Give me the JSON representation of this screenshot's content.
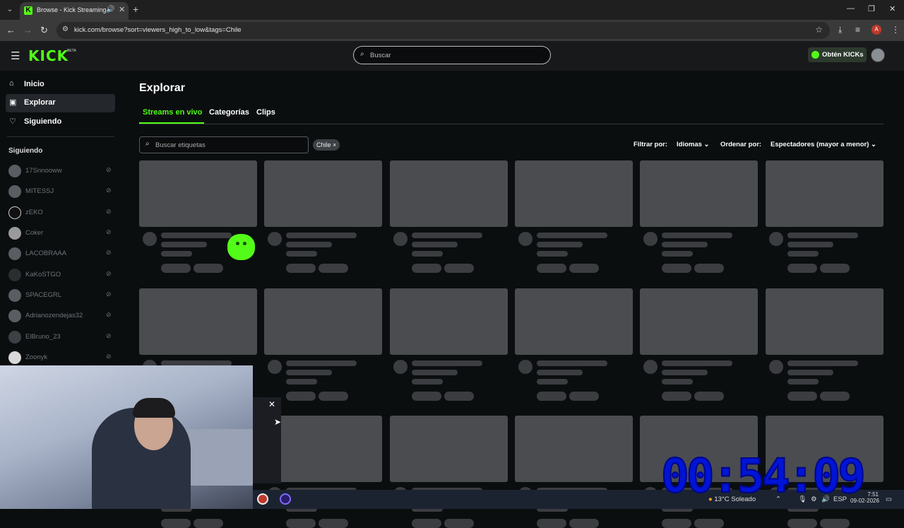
{
  "browser": {
    "tab_title": "Browse - Kick Streaming",
    "url": "kick.com/browse?sort=viewers_high_to_low&tags=Chile",
    "profile_initial": "A"
  },
  "header": {
    "logo": "KICK",
    "beta": "BETA",
    "search_placeholder": "Buscar",
    "get_kicks": "Obtén KICKs"
  },
  "sidebar": {
    "items": [
      {
        "label": "Inicio",
        "icon": "home-icon"
      },
      {
        "label": "Explorar",
        "icon": "browse-icon"
      },
      {
        "label": "Siguiendo",
        "icon": "heart-icon"
      }
    ],
    "following_heading": "Siguiendo",
    "following": [
      "17Snnooww",
      "MITESSJ",
      "zEKO",
      "Coker",
      "LACOBRAAA",
      "KaKoSTGO",
      "SPACEGRL",
      "Adrianozendejas32",
      "ElBruno_23",
      "Zoonyk"
    ]
  },
  "main": {
    "title": "Explorar",
    "tabs": [
      "Streams en vivo",
      "Categorías",
      "Clips"
    ],
    "tag_search_placeholder": "Buscar etiquetas",
    "active_tag": "Chile",
    "filter_label": "Filtrar por:",
    "filter_value": "Idiomas",
    "sort_label": "Ordenar por:",
    "sort_value": "Espectadores (mayor a menor)"
  },
  "taskbar": {
    "weather": "13°C  Soleado",
    "lang": "ESP",
    "time": "7:51",
    "date": "09-02-2026"
  },
  "overlay_timer": "00:54:09",
  "colors": {
    "accent": "#53fc18",
    "timer": "#0014d6"
  }
}
